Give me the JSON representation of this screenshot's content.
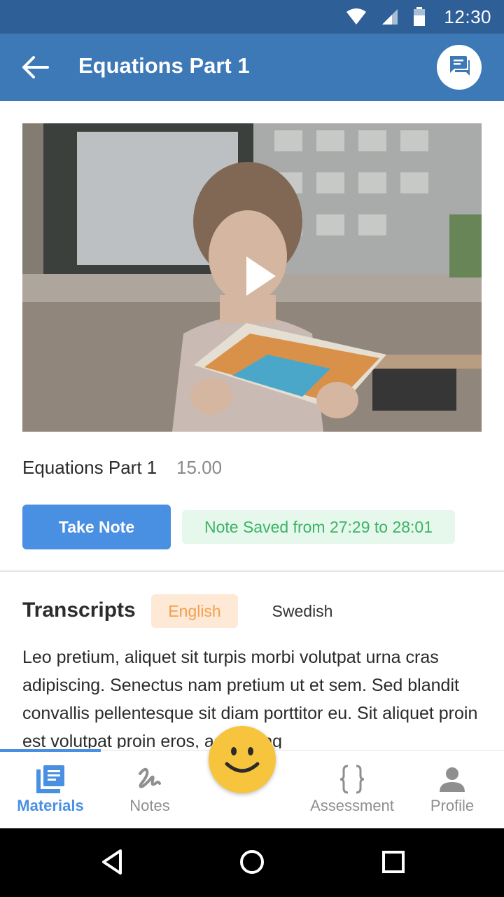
{
  "status_bar": {
    "time": "12:30",
    "icons": [
      "wifi-icon",
      "signal-icon",
      "battery-icon"
    ]
  },
  "app_bar": {
    "title": "Equations Part 1",
    "back_icon": "arrow-left-icon",
    "action_icon": "chat-icon"
  },
  "video": {
    "play_icon": "play-icon"
  },
  "lesson": {
    "title": "Equations Part 1",
    "duration": "15.00"
  },
  "actions": {
    "take_note_label": "Take Note",
    "note_saved_text": "Note Saved from 27:29 to 28:01"
  },
  "transcripts": {
    "title": "Transcripts",
    "languages": [
      {
        "label": "English",
        "selected": true
      },
      {
        "label": "Swedish",
        "selected": false
      }
    ],
    "text": "Leo pretium, aliquet sit turpis morbi volutpat urna cras adipiscing. Senectus nam pretium ut et sem. Sed blandit convallis pellentesque sit diam porttitor eu. Sit aliquet proin est volutpat proin eros, adipiscing"
  },
  "bottom_nav": {
    "items": [
      {
        "label": "Materials",
        "icon": "materials-icon",
        "active": true
      },
      {
        "label": "Notes",
        "icon": "notes-icon",
        "active": false
      },
      {
        "label": "Assessment",
        "icon": "braces-icon",
        "active": false
      },
      {
        "label": "Profile",
        "icon": "person-icon",
        "active": false
      }
    ],
    "center_icon": "smiley-icon"
  },
  "system_nav": {
    "icons": [
      "back-triangle-icon",
      "home-circle-icon",
      "recents-square-icon"
    ]
  },
  "colors": {
    "status_bar": "#2f5f97",
    "app_bar": "#3d78b7",
    "accent": "#4a90e2",
    "success_text": "#3bb464",
    "success_bg": "#e6f7ec",
    "english_tag_text": "#f2a04f",
    "english_tag_bg": "#fde9d6",
    "smiley": "#f7c43d"
  }
}
